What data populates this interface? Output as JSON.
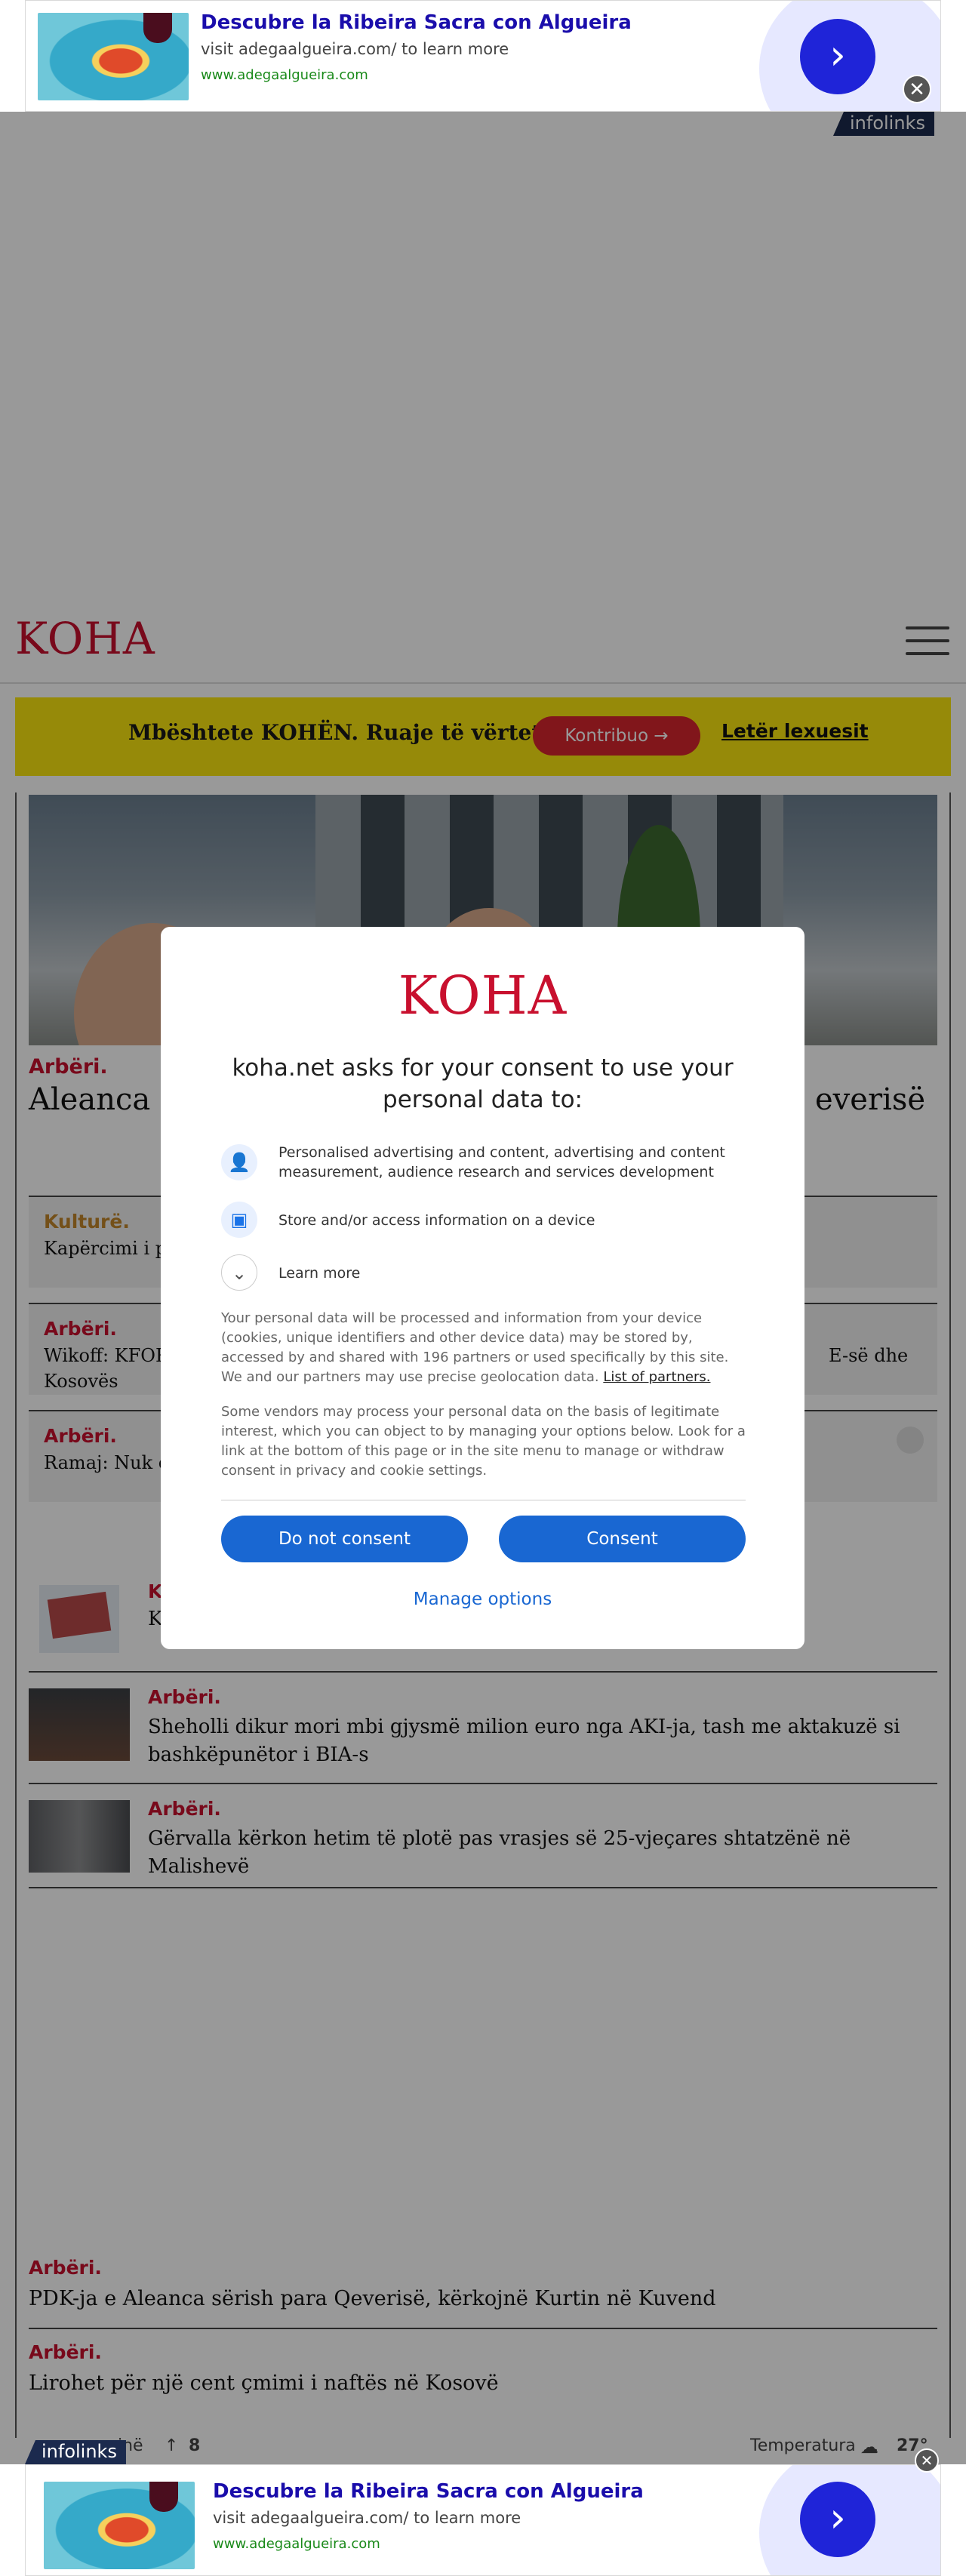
{
  "ad_top": {
    "title": "Descubre la Ribeira Sacra con Algueira",
    "subtitle": "visit adegaalgueira.com/ to learn more",
    "url": "www.adegaalgueira.com",
    "go_icon": "›",
    "close_icon": "✕",
    "badge": "infolinks"
  },
  "header": {
    "logo": "KOHA",
    "menu_icon": "hamburger-menu"
  },
  "support": {
    "text": "Mbështete KOHËN. Ruaje të vërtetën",
    "contribute_label": "Kontribuo →",
    "newsletter_label": "Letër lexuesit"
  },
  "hero": {
    "kicker": "Arbëri.",
    "headline_start": "Aleanca d",
    "headline_end": "everisë"
  },
  "boxes": [
    {
      "kicker": "Kulturë.",
      "text": "Kapërcimi i pe"
    },
    {
      "kicker": "Arbëri.",
      "text": "Wikoff: KFOR",
      "text2": "Kosovës",
      "text_end": "E-së dhe"
    },
    {
      "kicker": "Arbëri.",
      "text": "Ramaj: Nuk ë"
    }
  ],
  "list": [
    {
      "kicker": "K",
      "text": "K"
    },
    {
      "kicker": "Arbëri.",
      "text": "Sheholli dikur mori mbi gjysmë milion euro nga AKI-ja, tash me aktakuzë si bashkëpunëtor i BIA-s"
    },
    {
      "kicker": "Arbëri.",
      "text": "Gërvalla kërkon hetim të plotë pas vrasjes së 25-vjeçares shtatzënë në Malishevë"
    }
  ],
  "bottom_list": [
    {
      "kicker": "Arbëri.",
      "text": "PDK-ja e Aleanca sërish para Qeverisë, kërkojnë Kurtin në Kuvend"
    },
    {
      "kicker": "Arbëri.",
      "text": "Lirohet për një cent çmimi i naftës në Kosovë"
    }
  ],
  "footer_stats": {
    "left_label": "inë",
    "arrow": "↑",
    "count": "8",
    "temp_label": "Temperatura",
    "temp_value": "27°"
  },
  "consent": {
    "logo": "KOHA",
    "title": "koha.net asks for your consent to use your personal data to:",
    "purposes": [
      {
        "icon": "user-icon",
        "glyph": "👤",
        "text": "Personalised advertising and content, advertising and content measurement, audience research and services development"
      },
      {
        "icon": "devices-icon",
        "glyph": "▣",
        "text": "Store and/or access information on a device"
      },
      {
        "icon": "chevron-down-icon",
        "glyph": "⌄",
        "text": "Learn more"
      }
    ],
    "body1": "Your personal data will be processed and information from your device (cookies, unique identifiers and other device data) may be stored by, accessed by and shared with 196 partners or used specifically by this site. We and our partners may use precise geolocation data.",
    "partners_link": "List of partners.",
    "body2": "Some vendors may process your personal data on the basis of legitimate interest, which you can object to by managing your options below. Look for a link at the bottom of this page or in the site menu to manage or withdraw consent in privacy and cookie settings.",
    "do_not_consent": "Do not consent",
    "consent": "Consent",
    "manage": "Manage options"
  },
  "ad_bottom": {
    "title": "Descubre la Ribeira Sacra con Algueira",
    "subtitle": "visit adegaalgueira.com/ to learn more",
    "url": "www.adegaalgueira.com",
    "go_icon": "›",
    "close_icon": "✕",
    "badge": "infolinks"
  }
}
